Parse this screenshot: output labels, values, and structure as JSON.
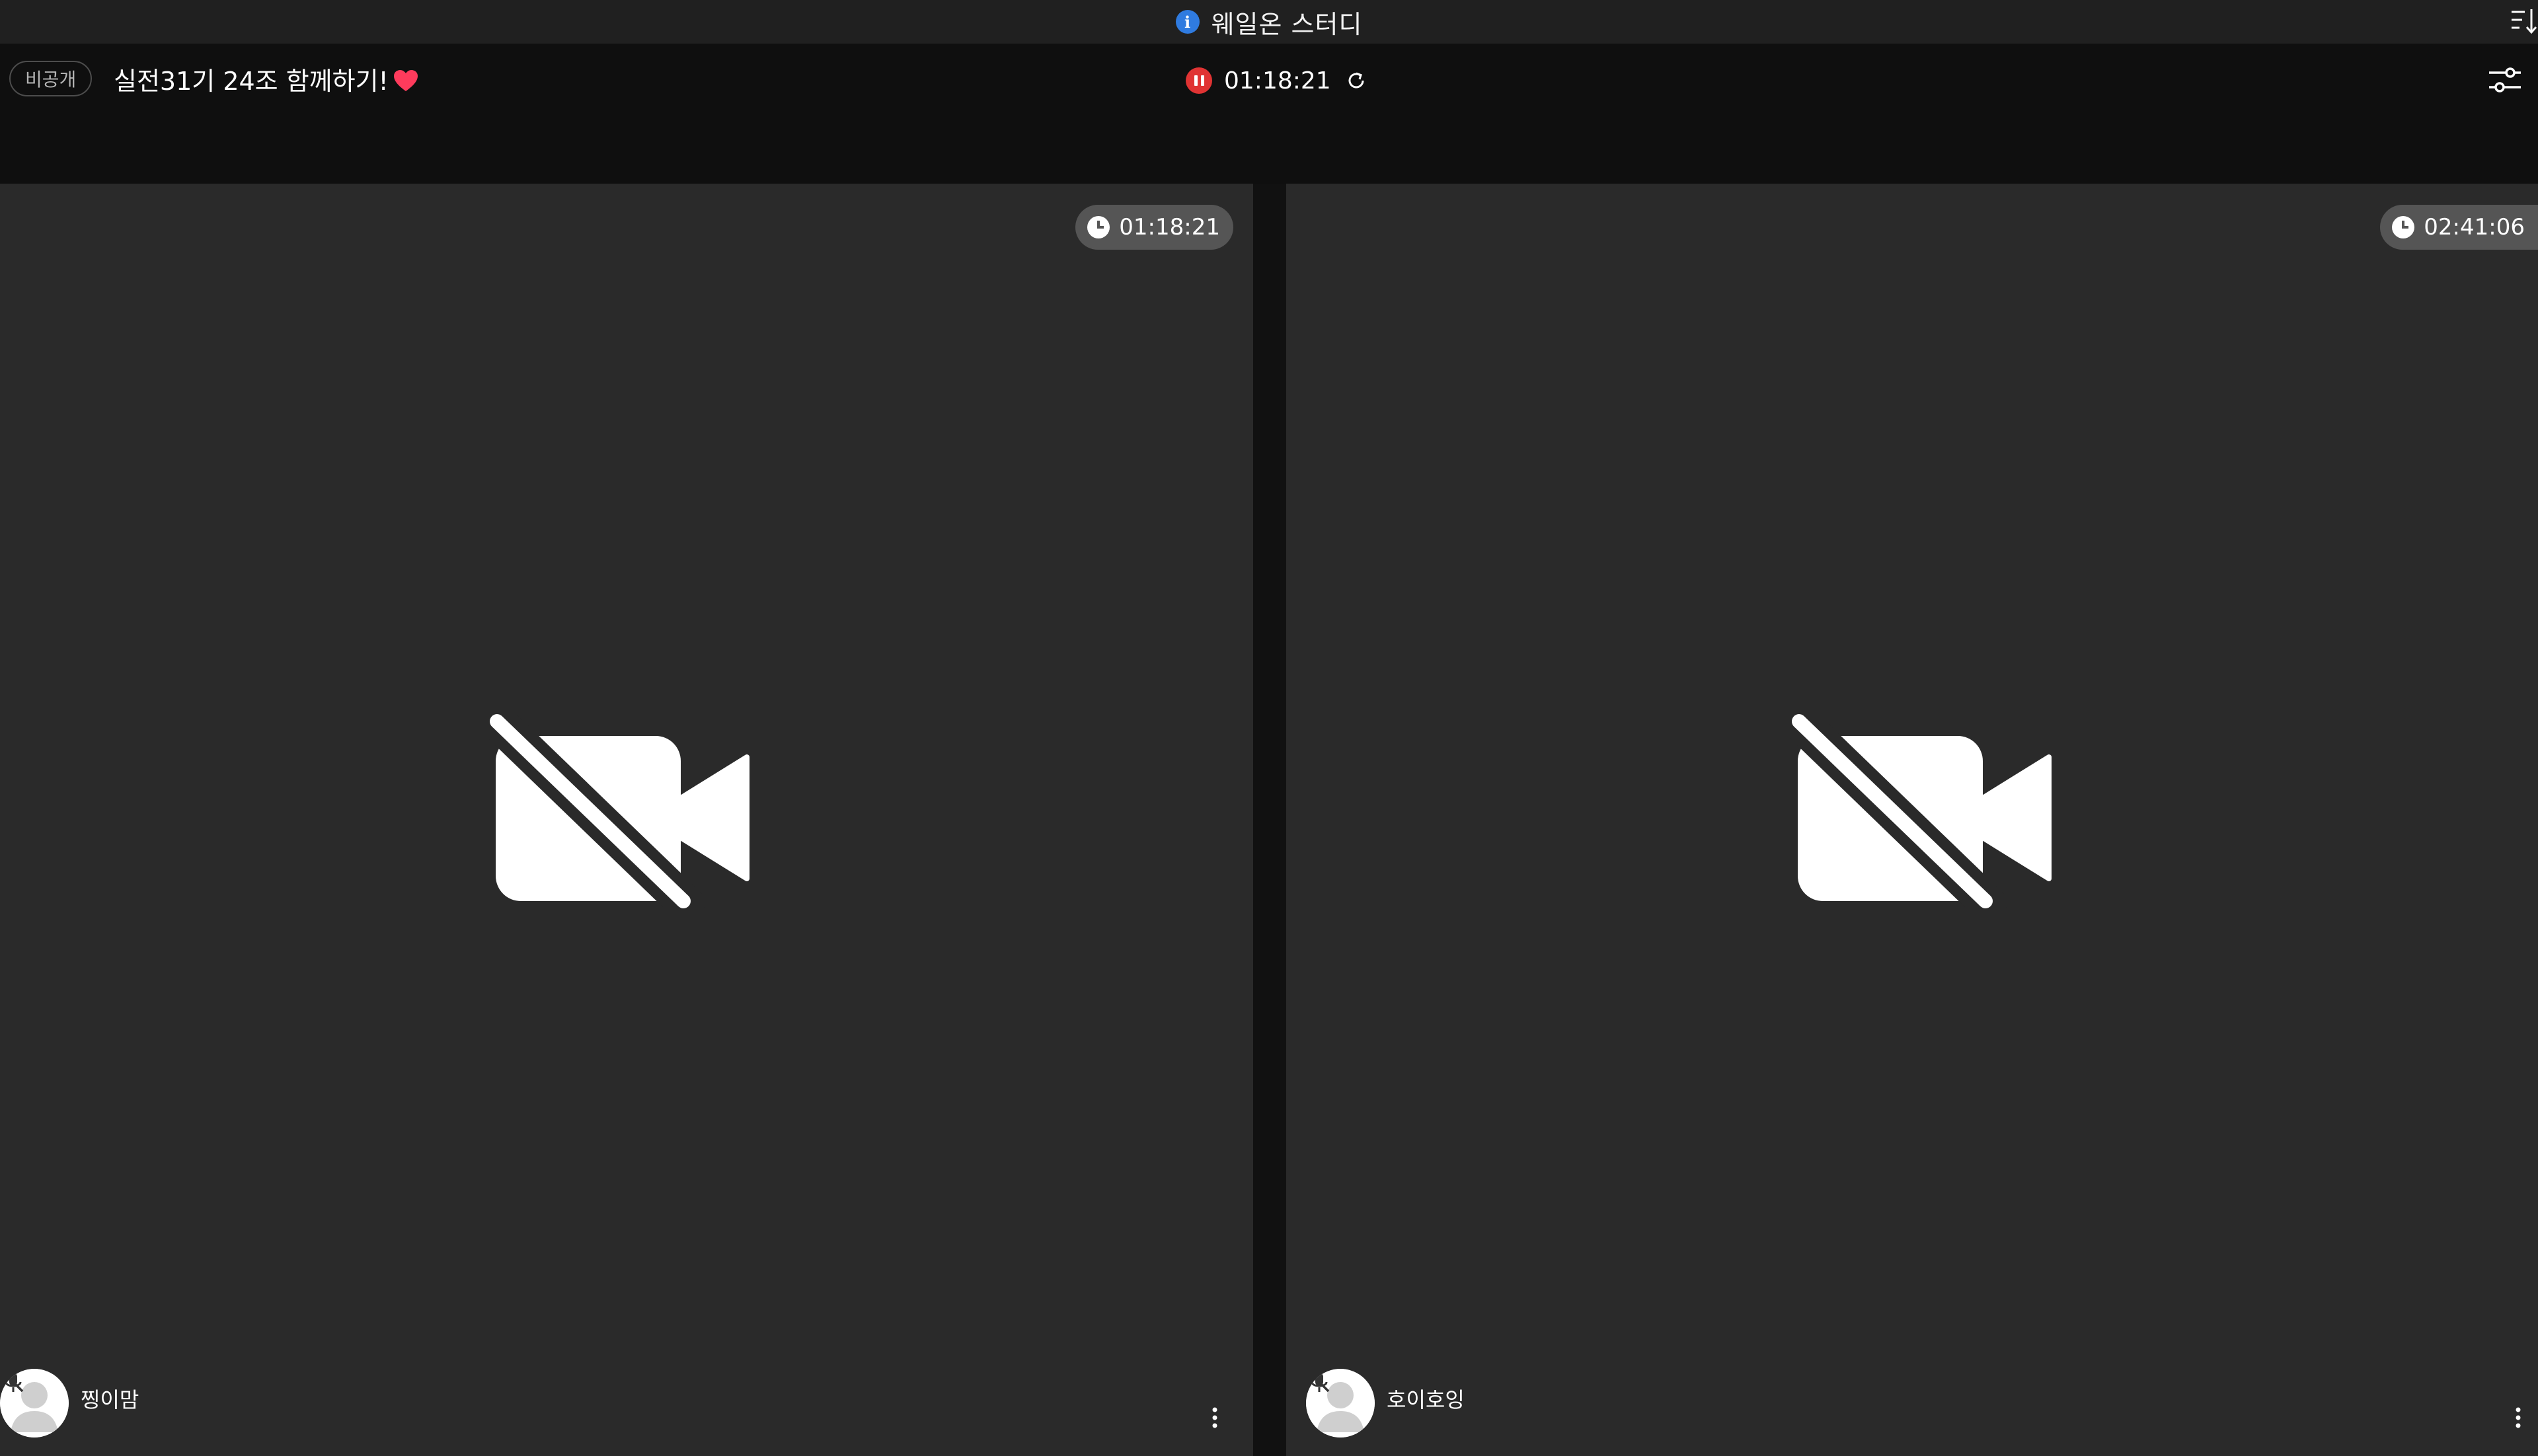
{
  "window": {
    "title": "웨일온 스터디",
    "info_icon_glyph": "i"
  },
  "header": {
    "privacy_badge": "비공개",
    "room_title": "실전31기 24조 함께하기!",
    "session_time": "01:18:21"
  },
  "colors": {
    "accent_red": "#e03333",
    "info_blue": "#2f7be0",
    "heart_pink": "#ff3b5c",
    "tile_bg": "#2a2a2a"
  },
  "icons": {
    "info": "info-icon",
    "sort": "sort-icon",
    "heart": "heart-icon",
    "pause": "pause-icon",
    "refresh": "refresh-icon",
    "settings": "settings-sliders-icon",
    "clock": "clock-icon",
    "camera_off": "camera-off-icon",
    "mic_off": "mic-off-icon",
    "more": "more-vertical-icon"
  },
  "participants": [
    {
      "name": "찡이맘",
      "study_time": "01:18:21",
      "camera": "off",
      "mic": "off"
    },
    {
      "name": "호이호잉",
      "study_time": "02:41:06",
      "camera": "off",
      "mic": "off"
    }
  ]
}
